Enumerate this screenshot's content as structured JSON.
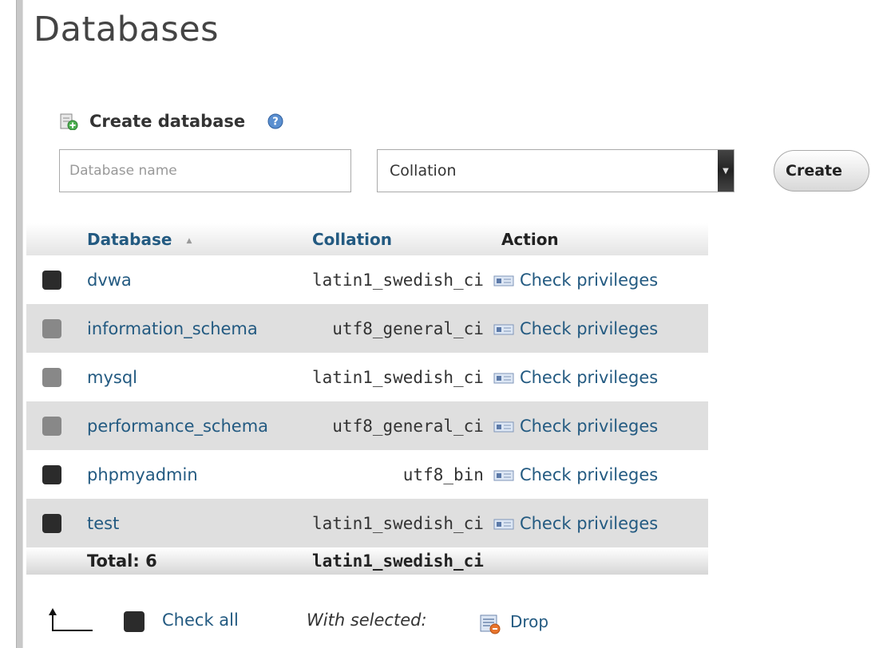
{
  "page": {
    "title": "Databases"
  },
  "create_database": {
    "heading": "Create database",
    "name_placeholder": "Database name",
    "collation_selected": "Collation",
    "create_button": "Create"
  },
  "table": {
    "columns": {
      "database": "Database",
      "collation": "Collation",
      "action": "Action"
    },
    "rows": [
      {
        "name": "dvwa",
        "collation": "latin1_swedish_ci",
        "action": "Check privileges",
        "selectable": true
      },
      {
        "name": "information_schema",
        "collation": "utf8_general_ci",
        "action": "Check privileges",
        "selectable": false
      },
      {
        "name": "mysql",
        "collation": "latin1_swedish_ci",
        "action": "Check privileges",
        "selectable": false
      },
      {
        "name": "performance_schema",
        "collation": "utf8_general_ci",
        "action": "Check privileges",
        "selectable": false
      },
      {
        "name": "phpmyadmin",
        "collation": "utf8_bin",
        "action": "Check privileges",
        "selectable": true
      },
      {
        "name": "test",
        "collation": "latin1_swedish_ci",
        "action": "Check privileges",
        "selectable": true
      }
    ],
    "total_label": "Total: 6",
    "total_collation": "latin1_swedish_ci"
  },
  "footer": {
    "check_all": "Check all",
    "with_selected": "With selected:",
    "drop": "Drop"
  },
  "colors": {
    "link": "#235a81",
    "row_alt": "#dfdfdf"
  }
}
